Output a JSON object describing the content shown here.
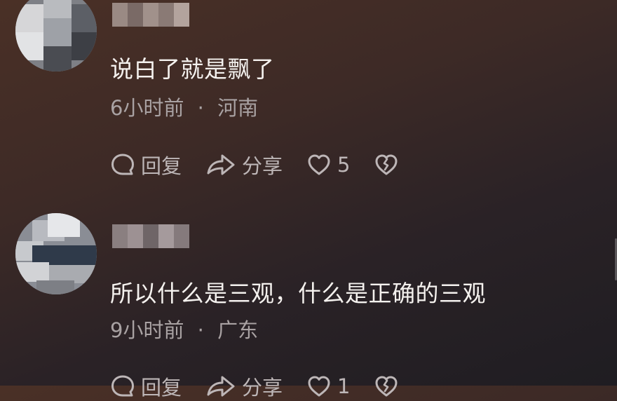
{
  "comments": [
    {
      "text": "说白了就是飘了",
      "time": "6小时前",
      "separator": "·",
      "location": "河南",
      "reply_label": "回复",
      "share_label": "分享",
      "like_count": "5"
    },
    {
      "text": "所以什么是三观，什么是正确的三观",
      "time": "9小时前",
      "separator": "·",
      "location": "广东",
      "reply_label": "回复",
      "share_label": "分享",
      "like_count": "1"
    }
  ],
  "icons": {
    "reply": "comment-bubble-icon",
    "share": "share-arrow-icon",
    "like": "heart-outline-icon",
    "dislike": "broken-heart-icon"
  },
  "colors": {
    "text": "#f4f1ee",
    "meta": "#a9a2a3",
    "action": "#bdb6b7"
  }
}
